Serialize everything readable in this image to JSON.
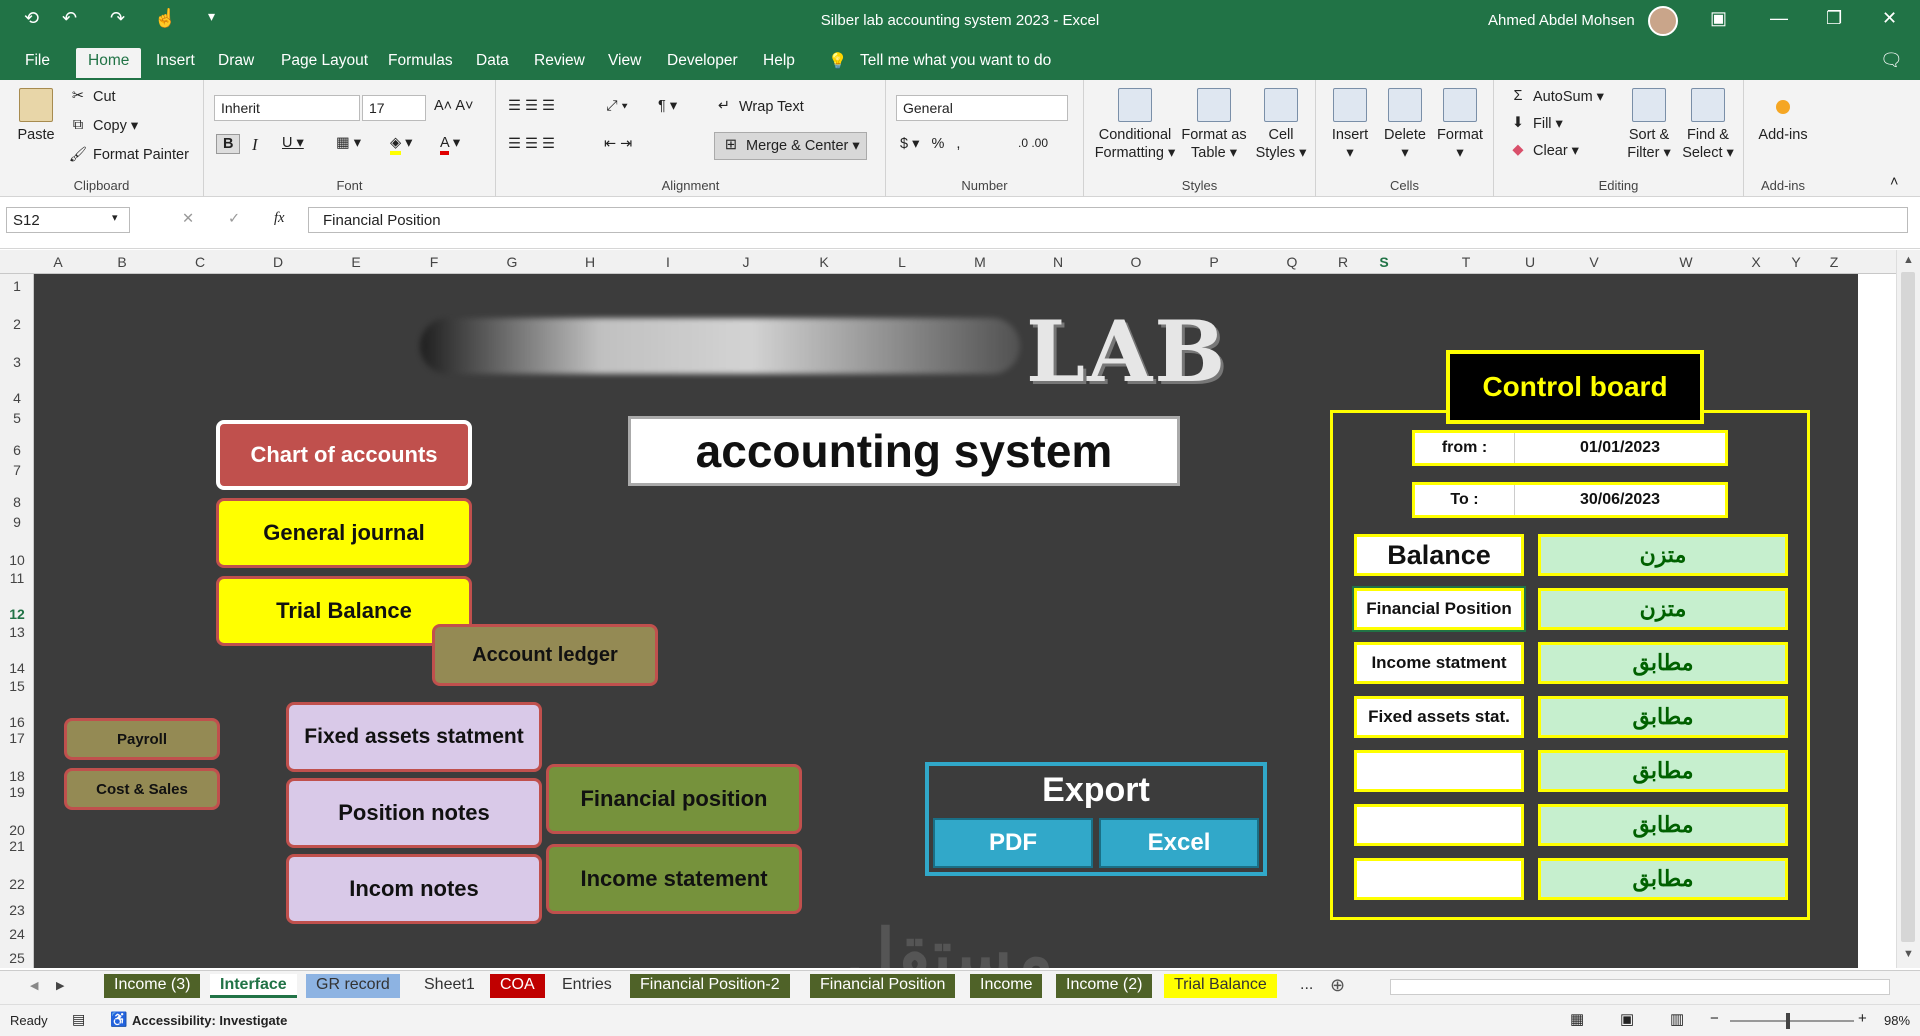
{
  "window": {
    "title": "Silber lab accounting system 2023  -  Excel",
    "user": "Ahmed Abdel Mohsen"
  },
  "menu": [
    "File",
    "Home",
    "Insert",
    "Draw",
    "Page Layout",
    "Formulas",
    "Data",
    "Review",
    "View",
    "Developer",
    "Help"
  ],
  "tell_me": "Tell me what you want to do",
  "ribbon": {
    "clipboard": {
      "paste": "Paste",
      "cut": "Cut",
      "copy": "Copy",
      "format_painter": "Format Painter",
      "label": "Clipboard"
    },
    "font": {
      "name": "Inherit",
      "size": "17",
      "label": "Font"
    },
    "alignment": {
      "wrap": "Wrap Text",
      "merge": "Merge & Center",
      "label": "Alignment"
    },
    "number": {
      "format": "General",
      "label": "Number"
    },
    "styles": {
      "cond": "Conditional",
      "cond2": "Formatting",
      "fat": "Format as",
      "fat2": "Table",
      "cs": "Cell",
      "cs2": "Styles",
      "label": "Styles"
    },
    "cells": {
      "insert": "Insert",
      "delete": "Delete",
      "format": "Format",
      "label": "Cells"
    },
    "editing": {
      "autosum": "AutoSum",
      "fill": "Fill",
      "clear": "Clear",
      "sort": "Sort &",
      "sort2": "Filter",
      "find": "Find &",
      "find2": "Select",
      "label": "Editing"
    },
    "addins": {
      "btn": "Add-ins",
      "label": "Add-ins"
    }
  },
  "formula_bar": {
    "name_box": "S12",
    "content": "Financial Position"
  },
  "columns": [
    "A",
    "B",
    "C",
    "D",
    "E",
    "F",
    "G",
    "H",
    "I",
    "J",
    "K",
    "L",
    "M",
    "N",
    "O",
    "P",
    "Q",
    "R",
    "S",
    "T",
    "U",
    "V",
    "W",
    "X",
    "Y",
    "Z"
  ],
  "rows": [
    "1",
    "2",
    "3",
    "4",
    "5",
    "6",
    "7",
    "8",
    "9",
    "10",
    "11",
    "12",
    "13",
    "14",
    "15",
    "16",
    "17",
    "18",
    "19",
    "20",
    "21",
    "22",
    "23",
    "24",
    "25"
  ],
  "logo": {
    "text": "LAB"
  },
  "app_title": "accounting system",
  "nav": {
    "chart_of_accounts": "Chart of accounts",
    "general_journal": "General journal",
    "trial_balance": "Trial Balance",
    "account_ledger": "Account ledger",
    "payroll": "Payroll",
    "cost_sales": "Cost & Sales",
    "fixed_assets": "Fixed assets statment",
    "position_notes": "Position notes",
    "incom_notes": "Incom notes",
    "financial_position": "Financial position",
    "income_statement": "Income statement"
  },
  "export": {
    "title": "Export",
    "pdf": "PDF",
    "excel": "Excel"
  },
  "control": {
    "title": "Control board",
    "from_label": "from :",
    "from_value": "01/01/2023",
    "to_label": "To :",
    "to_value": "30/06/2023",
    "rows": [
      {
        "label": "Balance",
        "status": "متزن"
      },
      {
        "label": "Financial Position",
        "status": "متزن"
      },
      {
        "label": "Income statment",
        "status": "مطابق"
      },
      {
        "label": "Fixed assets stat.",
        "status": "مطابق"
      },
      {
        "label": "",
        "status": "مطابق"
      },
      {
        "label": "",
        "status": "مطابق"
      },
      {
        "label": "",
        "status": "مطابق"
      }
    ]
  },
  "sheet_tabs": [
    "Income (3)",
    "Interface",
    "GR record",
    "Sheet1",
    "COA",
    "Entries",
    "Financial Position-2",
    "Financial Position",
    "Income",
    "Income (2)",
    "Trial Balance",
    "..."
  ],
  "status": {
    "ready": "Ready",
    "accessibility": "Accessibility: Investigate",
    "zoom": "98%"
  },
  "watermark": "مستقل",
  "colors": {
    "excel_green": "#217346",
    "sheet_bg": "#3c3c3c",
    "yellow": "#ffff00",
    "olive": "#76923c",
    "lavender": "#d9c9e8",
    "red_btn": "#c0504d",
    "teal": "#31a8c9"
  }
}
